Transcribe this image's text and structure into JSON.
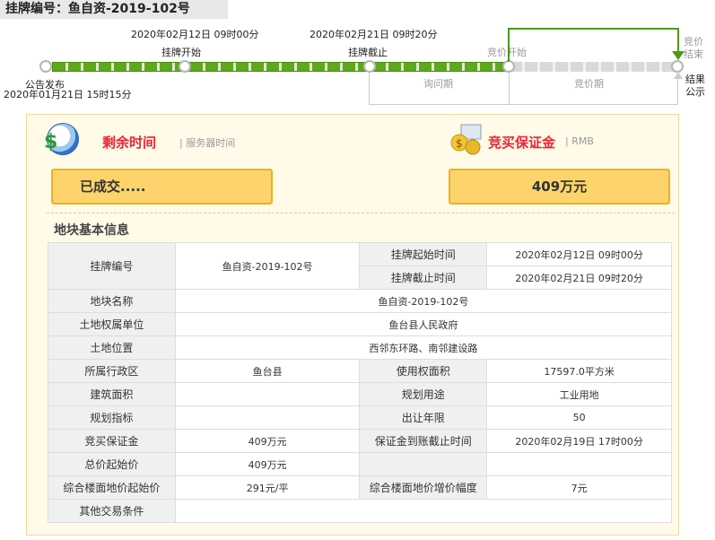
{
  "header": {
    "title": "挂牌编号：鱼自资-2019-102号"
  },
  "timeline": {
    "listing_start": {
      "label": "挂牌开始",
      "time": "2020年02月12日 09时00分"
    },
    "listing_end": {
      "label": "挂牌截止",
      "time": "2020年02月21日 09时20分"
    },
    "announcement": {
      "label": "公告发布",
      "time": "2020年01月21日 15时15分"
    },
    "bidding_start": {
      "label": "竞价开始"
    },
    "bidding_end": {
      "label": "竞价结束"
    },
    "result": {
      "label": "结果公示"
    },
    "inquiry_period": "询问期",
    "bidding_period": "竞价期"
  },
  "countdown": {
    "title": "剩余时间",
    "server_time": "服务器时间",
    "value": "已成交....."
  },
  "deposit": {
    "title": "竞买保证金",
    "unit": "RMB",
    "value": "409万元"
  },
  "section": {
    "title": "地块基本信息"
  },
  "table": {
    "listing_no_label": "挂牌编号",
    "listing_no": "鱼自资-2019-102号",
    "start_time_label": "挂牌起始时间",
    "start_time": "2020年02月12日 09时00分",
    "end_time_label": "挂牌截止时间",
    "end_time": "2020年02月21日 09时20分",
    "parcel_name_label": "地块名称",
    "parcel_name": "鱼自资-2019-102号",
    "owner_label": "土地权属单位",
    "owner": "鱼台县人民政府",
    "location_label": "土地位置",
    "location": "西邻东环路、南邻建设路",
    "district_label": "所属行政区",
    "district": "鱼台县",
    "use_area_label": "使用权面积",
    "use_area": "17597.0平方米",
    "building_area_label": "建筑面积",
    "building_area": "",
    "planned_use_label": "规划用途",
    "planned_use": "工业用地",
    "planning_index_label": "规划指标",
    "planning_index": "",
    "term_label": "出让年限",
    "term": "50",
    "deposit_label": "竞买保证金",
    "deposit": "409万元",
    "deposit_deadline_label": "保证金到账截止时间",
    "deposit_deadline": "2020年02月19日 17时00分",
    "start_price_label": "总价起始价",
    "start_price": "409万元",
    "floor_price_label": "综合楼面地价起始价",
    "floor_price": "291元/平",
    "increment_label": "综合楼面地价增价幅度",
    "increment": "7元",
    "other_label": "其他交易条件",
    "other": ""
  }
}
